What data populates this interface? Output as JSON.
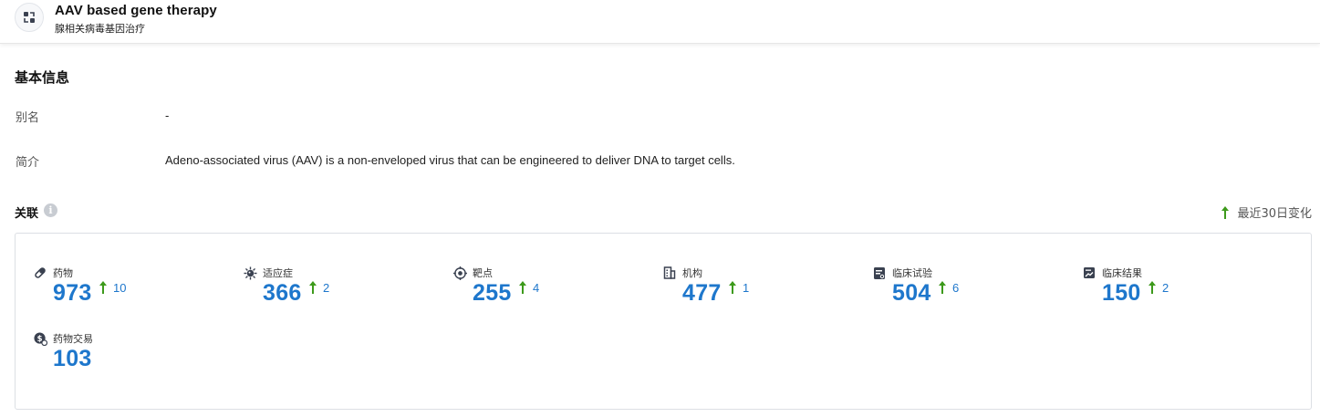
{
  "header": {
    "title": "AAV based gene therapy",
    "subtitle": "腺相关病毒基因治疗",
    "logo_icon": "gene-therapy-icon"
  },
  "basic_info": {
    "section_title": "基本信息",
    "rows": [
      {
        "label": "别名",
        "value": "-"
      },
      {
        "label": "简介",
        "value": "Adeno-associated virus (AAV) is a non-enveloped virus that can be engineered to deliver DNA to target cells."
      }
    ]
  },
  "relations": {
    "title": "关联",
    "info_icon": "info-icon",
    "legend_label": "最近30日变化",
    "accent_color": "#1e77cc",
    "up_color": "#3d9a1b",
    "stats": [
      {
        "key": "drug",
        "label": "药物",
        "icon": "pill-icon",
        "count": "973",
        "delta": "10"
      },
      {
        "key": "indication",
        "label": "适应症",
        "icon": "virus-icon",
        "count": "366",
        "delta": "2"
      },
      {
        "key": "target",
        "label": "靶点",
        "icon": "target-icon",
        "count": "255",
        "delta": "4"
      },
      {
        "key": "organization",
        "label": "机构",
        "icon": "building-icon",
        "count": "477",
        "delta": "1"
      },
      {
        "key": "clinical_trial",
        "label": "临床试验",
        "icon": "clipboard-icon",
        "count": "504",
        "delta": "6"
      },
      {
        "key": "clinical_result",
        "label": "临床结果",
        "icon": "chart-report-icon",
        "count": "150",
        "delta": "2"
      },
      {
        "key": "drug_deal",
        "label": "药物交易",
        "icon": "deal-icon",
        "count": "103",
        "delta": ""
      }
    ]
  }
}
